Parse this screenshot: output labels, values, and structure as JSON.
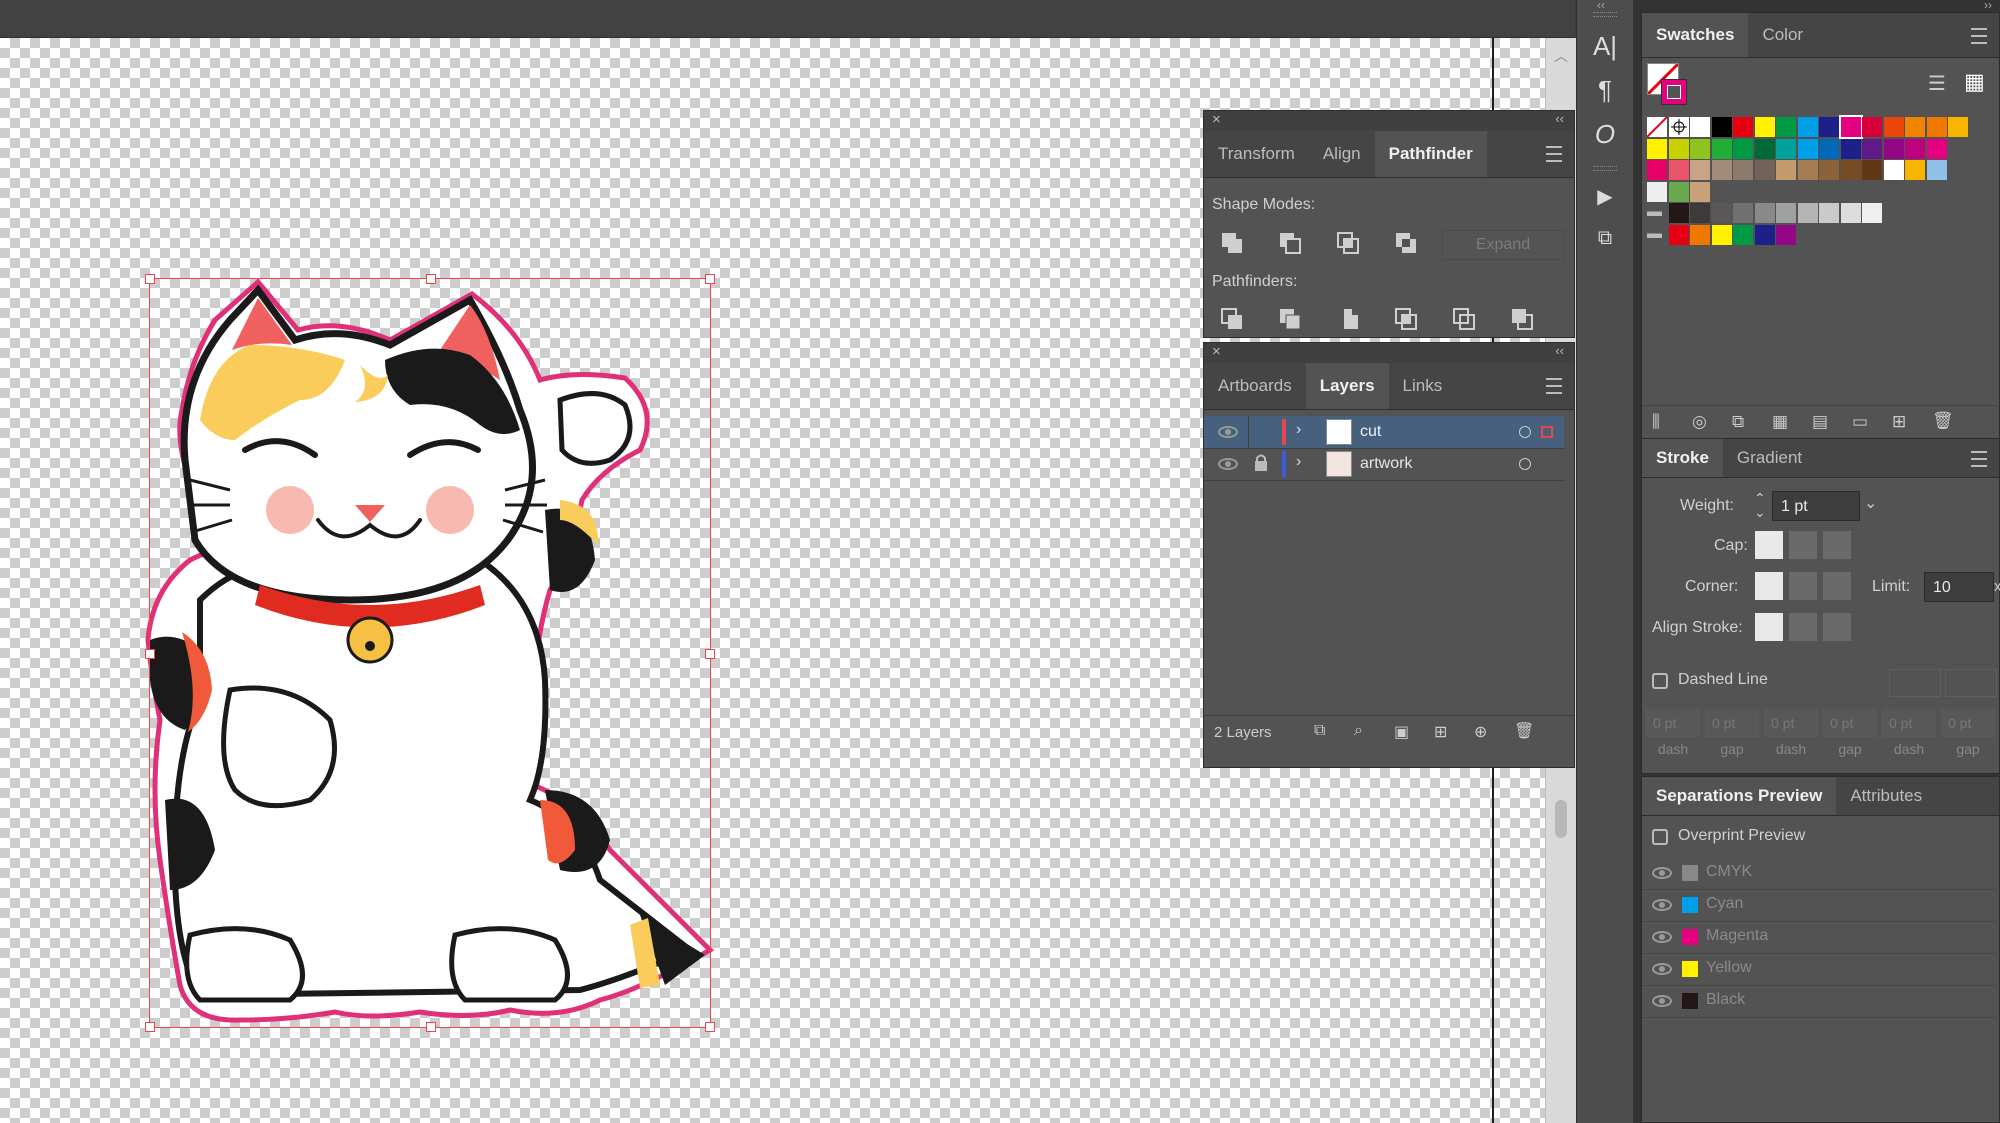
{
  "panels": {
    "pathfinder_group": {
      "tabs": [
        {
          "label": "Transform",
          "active": false
        },
        {
          "label": "Align",
          "active": false
        },
        {
          "label": "Pathfinder",
          "active": true
        }
      ],
      "shape_modes_label": "Shape Modes:",
      "expand_label": "Expand",
      "pathfinders_label": "Pathfinders:"
    },
    "layers_group": {
      "tabs": [
        {
          "label": "Artboards",
          "active": false
        },
        {
          "label": "Layers",
          "active": true
        },
        {
          "label": "Links",
          "active": false
        }
      ],
      "layers": [
        {
          "name": "cut",
          "color": "#e8474b",
          "locked": false,
          "selected": true
        },
        {
          "name": "artwork",
          "color": "#3c5ce0",
          "locked": true,
          "selected": false
        }
      ],
      "count_label": "2 Layers"
    },
    "swatches_group": {
      "tabs": [
        {
          "label": "Swatches",
          "active": true
        },
        {
          "label": "Color",
          "active": false
        }
      ]
    },
    "stroke_group": {
      "tabs": [
        {
          "label": "Stroke",
          "active": true
        },
        {
          "label": "Gradient",
          "active": false
        }
      ],
      "weight_label": "Weight:",
      "weight_value": "1 pt",
      "cap_label": "Cap:",
      "corner_label": "Corner:",
      "limit_label": "Limit:",
      "limit_value": "10",
      "limit_unit": "x",
      "align_stroke_label": "Align Stroke:",
      "dashed_line_label": "Dashed Line",
      "dash_fields": [
        {
          "value": "0 pt",
          "label": "dash"
        },
        {
          "value": "0 pt",
          "label": "gap"
        },
        {
          "value": "0 pt",
          "label": "dash"
        },
        {
          "value": "0 pt",
          "label": "gap"
        },
        {
          "value": "0 pt",
          "label": "dash"
        },
        {
          "value": "0 pt",
          "label": "gap"
        }
      ]
    },
    "separations_group": {
      "tabs": [
        {
          "label": "Separations Preview",
          "active": true
        },
        {
          "label": "Attributes",
          "active": false
        }
      ],
      "overprint_label": "Overprint Preview",
      "plates": [
        {
          "name": "CMYK",
          "color": "#888888"
        },
        {
          "name": "Cyan",
          "color": "#00a0e9"
        },
        {
          "name": "Magenta",
          "color": "#e4007f"
        },
        {
          "name": "Yellow",
          "color": "#fff100"
        },
        {
          "name": "Black",
          "color": "#231815"
        }
      ]
    }
  },
  "colors": {
    "selection": "#e8474b",
    "cut_line": "#e0307a"
  },
  "swatch_rows": [
    [
      "none",
      "registration",
      "#ffffff",
      "#000000",
      "#e60012",
      "#fff100",
      "#009944",
      "#00a0e9",
      "#1d2088",
      "#e4007f",
      "#d7003a",
      "#e94709",
      "#f08300",
      "#ee7800",
      "#f8b500"
    ],
    [
      "#fff100",
      "#c9d200",
      "#8fc31f",
      "#22ac38",
      "#009944",
      "#006934",
      "#00a29a",
      "#00a0e9",
      "#0068b7",
      "#1d2088",
      "#601986",
      "#920783",
      "#be0081",
      "#e4007f"
    ],
    [
      "#e5006a",
      "#e9546b",
      "#c9a385",
      "#a48b78",
      "#8c7b6d",
      "#736357",
      "#c49a6c",
      "#a67c52",
      "#8c6239",
      "#754c24",
      "#603813",
      "#ffffff",
      "#f8b500",
      "#8fc1e8"
    ],
    [
      "pattern-dots",
      "pattern-leaf",
      "pattern-tile"
    ],
    [
      "folder",
      "#231815",
      "#3e3a39",
      "#595757",
      "#727171",
      "#898989",
      "#9fa0a0",
      "#b5b5b6",
      "#c9caca",
      "#dcdddd",
      "#efefef"
    ],
    [
      "folder",
      "#e60012",
      "#ee7800",
      "#fff100",
      "#009944",
      "#1d2088",
      "#920783"
    ]
  ]
}
